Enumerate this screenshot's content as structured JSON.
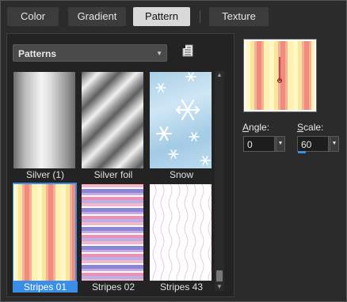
{
  "tabs": [
    {
      "label": "Color"
    },
    {
      "label": "Gradient"
    },
    {
      "label": "Pattern"
    },
    {
      "label": "Texture"
    }
  ],
  "active_tab": "Pattern",
  "category_dropdown": {
    "value": "Patterns"
  },
  "patterns": [
    {
      "label": "Silver (1)"
    },
    {
      "label": "Silver foil"
    },
    {
      "label": "Snow"
    },
    {
      "label": "Stripes 01"
    },
    {
      "label": "Stripes 02"
    },
    {
      "label": "Stripes 43"
    }
  ],
  "selected_pattern": "Stripes 01",
  "angle": {
    "label_prefix": "",
    "label_accel": "A",
    "label_rest": "ngle:",
    "value": "0"
  },
  "scale": {
    "label_accel": "S",
    "label_rest": "cale:",
    "value": "60"
  },
  "colors": {
    "accent": "#3a8ee6",
    "active_tab_bg": "#d9d9d9",
    "background": "#2b2b2b"
  },
  "icons": {
    "browse": "pattern-browse-icon",
    "scroll_up": "chevron-up-icon",
    "scroll_down": "chevron-down-icon"
  }
}
